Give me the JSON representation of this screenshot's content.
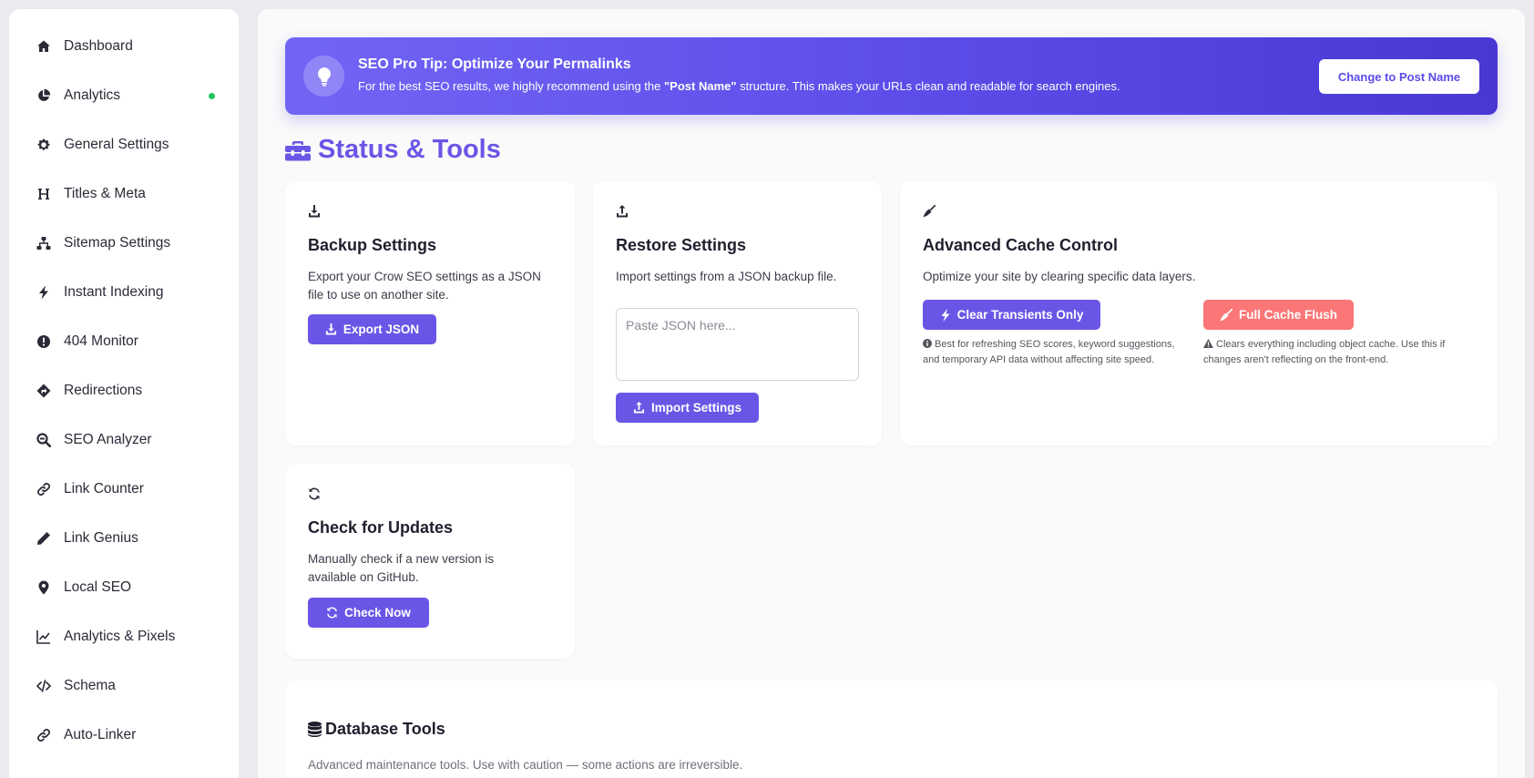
{
  "sidebar": {
    "items": [
      {
        "label": "Dashboard",
        "icon": "home-icon"
      },
      {
        "label": "Analytics",
        "icon": "pie-chart-icon",
        "active_dot_color": "#22c55e"
      },
      {
        "label": "General Settings",
        "icon": "gear-icon"
      },
      {
        "label": "Titles & Meta",
        "icon": "heading-icon"
      },
      {
        "label": "Sitemap Settings",
        "icon": "sitemap-icon"
      },
      {
        "label": "Instant Indexing",
        "icon": "bolt-icon"
      },
      {
        "label": "404 Monitor",
        "icon": "alert-circle-icon"
      },
      {
        "label": "Redirections",
        "icon": "directions-icon"
      },
      {
        "label": "SEO Analyzer",
        "icon": "search-icon"
      },
      {
        "label": "Link Counter",
        "icon": "link-icon"
      },
      {
        "label": "Link Genius",
        "icon": "pen-icon"
      },
      {
        "label": "Local SEO",
        "icon": "map-pin-icon"
      },
      {
        "label": "Analytics & Pixels",
        "icon": "line-chart-icon"
      },
      {
        "label": "Schema",
        "icon": "code-icon"
      },
      {
        "label": "Auto-Linker",
        "icon": "link-icon"
      }
    ]
  },
  "tip": {
    "title": "SEO Pro Tip: Optimize Your Permalinks",
    "text_before": "For the best SEO results, we highly recommend using the ",
    "text_bold": "\"Post Name\"",
    "text_after": " structure. This makes your URLs clean and readable for search engines.",
    "button": "Change to Post Name"
  },
  "section": {
    "title": "Status & Tools"
  },
  "backup": {
    "title": "Backup Settings",
    "desc_line1": "Export your Crow SEO settings as a JSON",
    "desc_line2": "file to use on another site.",
    "button": "Export JSON"
  },
  "restore": {
    "title": "Restore Settings",
    "desc": "Import settings from a JSON backup file.",
    "placeholder": "Paste JSON here...",
    "button": "Import Settings"
  },
  "cache": {
    "title": "Advanced Cache Control",
    "desc": "Optimize your site by clearing specific data layers.",
    "btn_transients": "Clear Transients Only",
    "btn_flush": "Full Cache Flush",
    "note_transients_line1": "Best for refreshing SEO scores, keyword suggestions,",
    "note_transients_line2": "and temporary API data without affecting site speed.",
    "note_flush_line1": "Clears everything including object cache. Use this if",
    "note_flush_line2": "changes aren't reflecting on the front-end."
  },
  "updates": {
    "title": "Check for Updates",
    "desc_line1": "Manually check if a new version is",
    "desc_line2": "available on GitHub.",
    "button": "Check Now"
  },
  "database": {
    "title": "Database Tools",
    "desc": "Advanced maintenance tools. Use with caution — some actions are irreversible."
  },
  "colors": {
    "accent": "#6a56e6",
    "danger": "#fb7777",
    "status_green": "#22c55e"
  }
}
